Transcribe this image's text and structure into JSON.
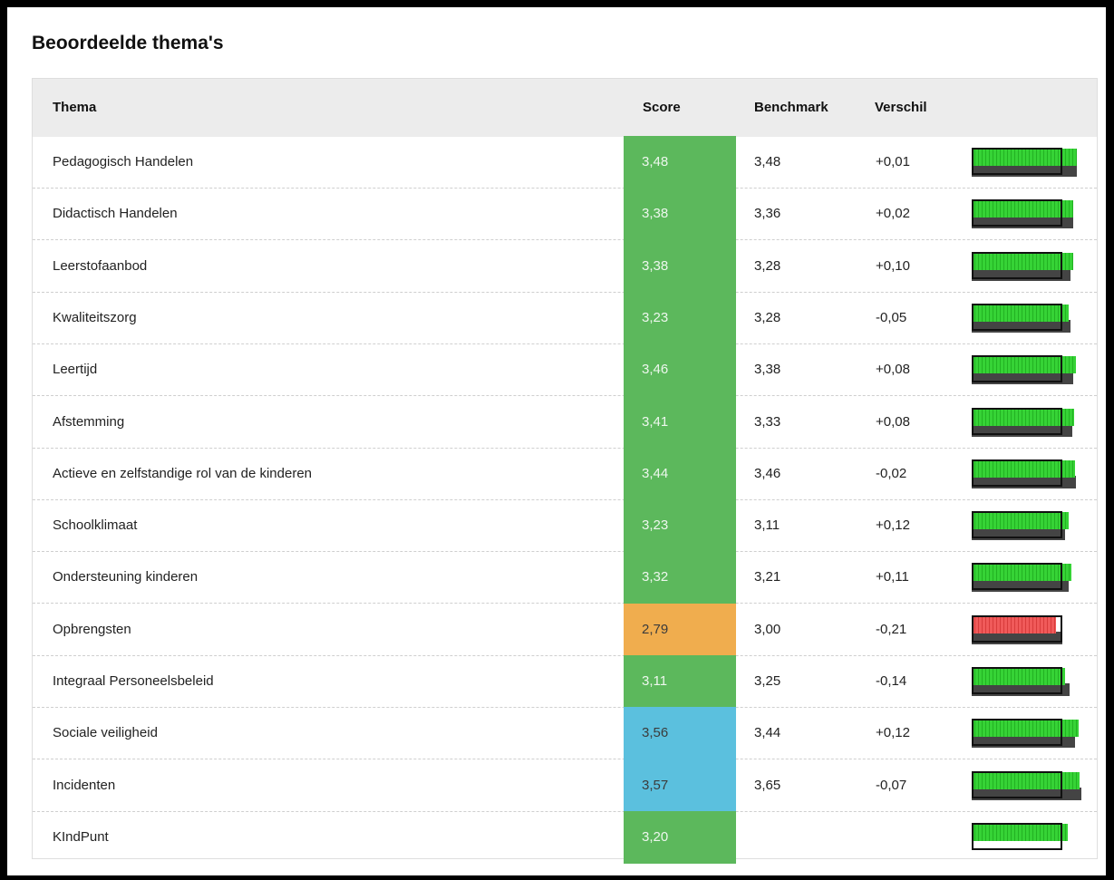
{
  "title": "Beoordeelde thema's",
  "columns": {
    "thema": "Thema",
    "score": "Score",
    "benchmark": "Benchmark",
    "verschil": "Verschil"
  },
  "colors": {
    "green": "#5cb85c",
    "orange": "#f0ad4e",
    "blue": "#5bc0de"
  },
  "rows": [
    {
      "thema": "Pedagogisch Handelen",
      "score": "3,48",
      "benchmark": "3,48",
      "verschil": "+0,01",
      "color": "green",
      "score_value": 3.48,
      "bench_value": 3.48
    },
    {
      "thema": "Didactisch Handelen",
      "score": "3,38",
      "benchmark": "3,36",
      "verschil": "+0,02",
      "color": "green",
      "score_value": 3.38,
      "bench_value": 3.36
    },
    {
      "thema": "Leerstofaanbod",
      "score": "3,38",
      "benchmark": "3,28",
      "verschil": "+0,10",
      "color": "green",
      "score_value": 3.38,
      "bench_value": 3.28
    },
    {
      "thema": "Kwaliteitszorg",
      "score": "3,23",
      "benchmark": "3,28",
      "verschil": "-0,05",
      "color": "green",
      "score_value": 3.23,
      "bench_value": 3.28
    },
    {
      "thema": "Leertijd",
      "score": "3,46",
      "benchmark": "3,38",
      "verschil": "+0,08",
      "color": "green",
      "score_value": 3.46,
      "bench_value": 3.38
    },
    {
      "thema": "Afstemming",
      "score": "3,41",
      "benchmark": "3,33",
      "verschil": "+0,08",
      "color": "green",
      "score_value": 3.41,
      "bench_value": 3.33
    },
    {
      "thema": "Actieve en zelfstandige rol van de kinderen",
      "score": "3,44",
      "benchmark": "3,46",
      "verschil": "-0,02",
      "color": "green",
      "score_value": 3.44,
      "bench_value": 3.46
    },
    {
      "thema": "Schoolklimaat",
      "score": "3,23",
      "benchmark": "3,11",
      "verschil": "+0,12",
      "color": "green",
      "score_value": 3.23,
      "bench_value": 3.11
    },
    {
      "thema": "Ondersteuning kinderen",
      "score": "3,32",
      "benchmark": "3,21",
      "verschil": "+0,11",
      "color": "green",
      "score_value": 3.32,
      "bench_value": 3.21
    },
    {
      "thema": "Opbrengsten",
      "score": "2,79",
      "benchmark": "3,00",
      "verschil": "-0,21",
      "color": "orange",
      "score_value": 2.79,
      "bench_value": 3.0
    },
    {
      "thema": "Integraal Personeelsbeleid",
      "score": "3,11",
      "benchmark": "3,25",
      "verschil": "-0,14",
      "color": "green",
      "score_value": 3.11,
      "bench_value": 3.25
    },
    {
      "thema": "Sociale veiligheid",
      "score": "3,56",
      "benchmark": "3,44",
      "verschil": "+0,12",
      "color": "blue",
      "score_value": 3.56,
      "bench_value": 3.44
    },
    {
      "thema": "Incidenten",
      "score": "3,57",
      "benchmark": "3,65",
      "verschil": "-0,07",
      "color": "blue",
      "score_value": 3.57,
      "bench_value": 3.65
    },
    {
      "thema": "KIndPunt",
      "score": "3,20",
      "benchmark": "",
      "verschil": "",
      "color": "green",
      "score_value": 3.2,
      "bench_value": null
    }
  ]
}
